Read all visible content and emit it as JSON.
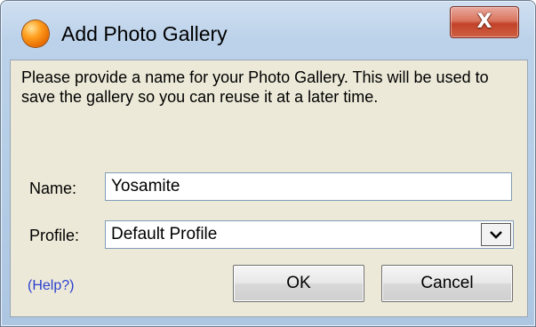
{
  "window": {
    "title": "Add Photo Gallery",
    "close_label": "X"
  },
  "dialog": {
    "message": "Please provide a name for your Photo Gallery. This will be used to save the gallery so you can reuse it at a later time.",
    "name_label": "Name:",
    "name_value": "Yosamite",
    "profile_label": "Profile:",
    "profile_selected": "Default Profile",
    "help_link": "(Help?)",
    "ok_label": "OK",
    "cancel_label": "Cancel"
  },
  "colors": {
    "client_background": "#ece9d8",
    "help_link": "#2a3fd0",
    "close_button": "#c2432a"
  },
  "icons": {
    "app": "orange-sphere-icon",
    "close": "close-icon",
    "dropdown": "chevron-down-icon"
  }
}
